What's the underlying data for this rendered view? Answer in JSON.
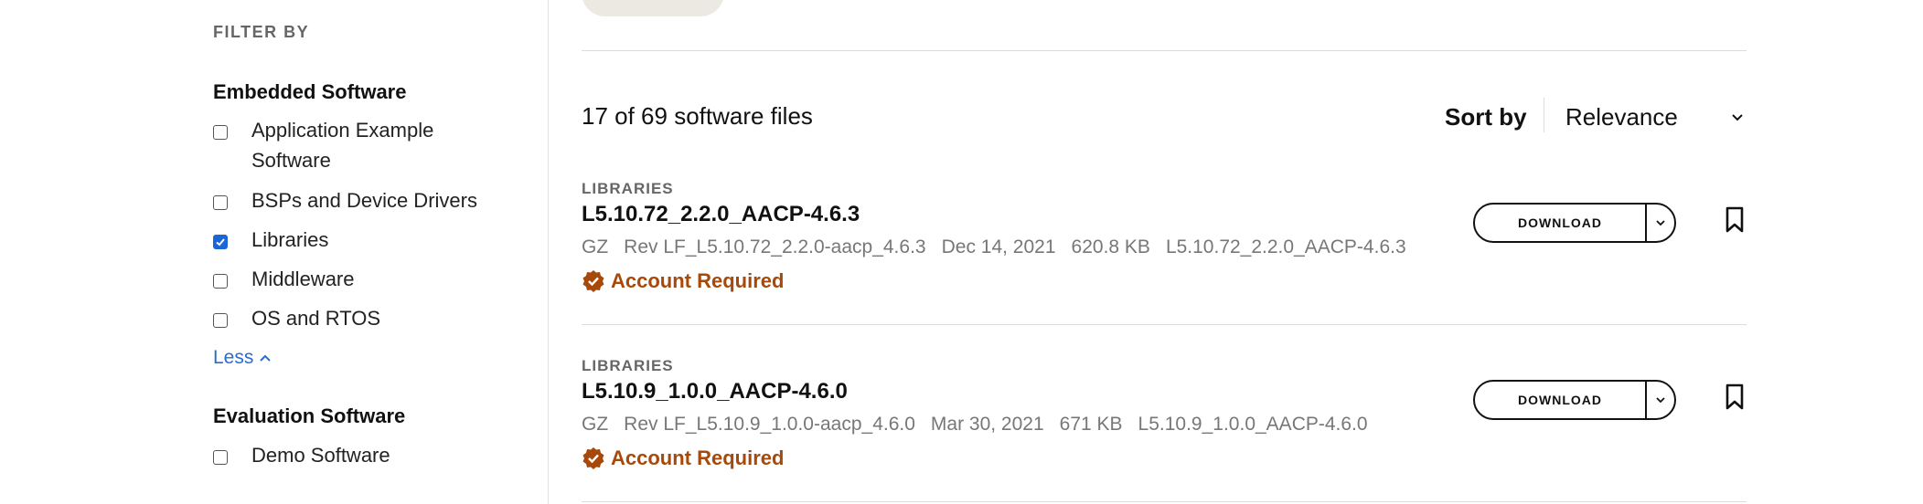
{
  "sidebar": {
    "filter_heading": "FILTER BY",
    "groups": [
      {
        "title": "Embedded Software",
        "options": [
          {
            "label": "Application Example Software",
            "checked": false
          },
          {
            "label": "BSPs and Device Drivers",
            "checked": false
          },
          {
            "label": "Libraries",
            "checked": true
          },
          {
            "label": "Middleware",
            "checked": false
          },
          {
            "label": "OS and RTOS",
            "checked": false
          }
        ],
        "toggle_label": "Less"
      },
      {
        "title": "Evaluation Software",
        "options": [
          {
            "label": "Demo Software",
            "checked": false
          }
        ]
      }
    ]
  },
  "results": {
    "count_text": "17 of 69 software files",
    "sort_label": "Sort by",
    "sort_value": "Relevance"
  },
  "items": [
    {
      "category": "LIBRARIES",
      "name": "L5.10.72_2.2.0_AACP-4.6.3",
      "type": "GZ",
      "revision": "Rev LF_L5.10.72_2.2.0-aacp_4.6.3",
      "date": "Dec 14, 2021",
      "size": "620.8 KB",
      "id": "L5.10.72_2.2.0_AACP-4.6.3",
      "account_text": "Account Required",
      "download_label": "DOWNLOAD"
    },
    {
      "category": "LIBRARIES",
      "name": "L5.10.9_1.0.0_AACP-4.6.0",
      "type": "GZ",
      "revision": "Rev LF_L5.10.9_1.0.0-aacp_4.6.0",
      "date": "Mar 30, 2021",
      "size": "671 KB",
      "id": "L5.10.9_1.0.0_AACP-4.6.0",
      "account_text": "Account Required",
      "download_label": "DOWNLOAD"
    }
  ],
  "colors": {
    "accent_blue": "#1a66d6",
    "account_orange": "#a6490a",
    "link_blue": "#2a6ccf"
  },
  "icons": {
    "checkbox_check": "check-icon",
    "less_toggle": "chevron-up-icon",
    "sort_toggle": "chevron-down-icon",
    "account": "verified-badge-icon",
    "bookmark": "bookmark-icon"
  }
}
